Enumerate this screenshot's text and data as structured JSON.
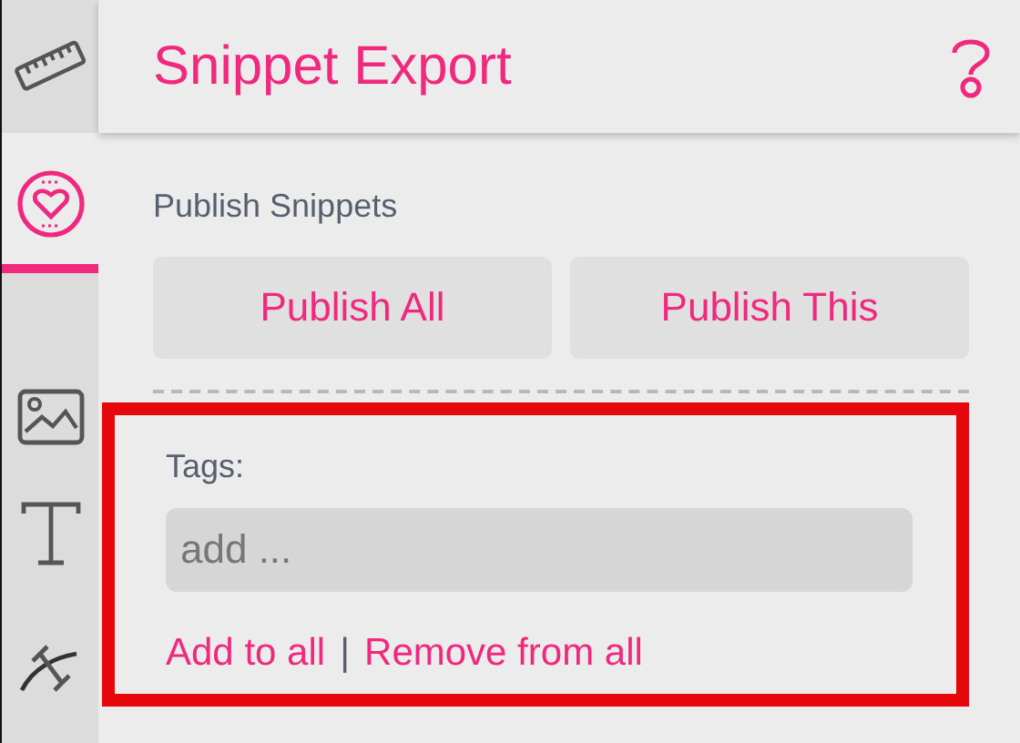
{
  "sidebar": {
    "items": [
      {
        "kind": "ruler",
        "selected": false
      },
      {
        "kind": "heart",
        "selected": true
      },
      {
        "kind": "image",
        "selected": false
      },
      {
        "kind": "text",
        "selected": false
      },
      {
        "kind": "curve",
        "selected": false
      }
    ]
  },
  "header": {
    "title": "Snippet Export"
  },
  "publish": {
    "heading": "Publish Snippets",
    "buttons": [
      "Publish All",
      "Publish This"
    ]
  },
  "tags": {
    "highlighted": true,
    "label": "Tags:",
    "placeholder": "add ...",
    "links": [
      "Add to all",
      "Remove from all"
    ],
    "separator": "|"
  }
}
